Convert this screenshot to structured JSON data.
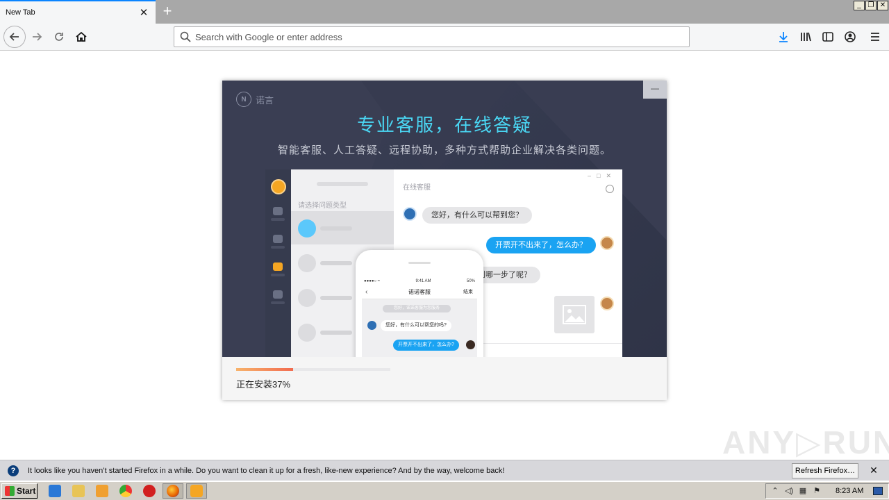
{
  "browser": {
    "tab_title": "New Tab",
    "tab_close": "✕",
    "new_tab": "+",
    "url_placeholder": "Search with Google or enter address",
    "url_value": "",
    "window_controls": [
      "_",
      "❐",
      "✕"
    ],
    "accent_color": "#0a84ff",
    "toolbar_icons": [
      "download-icon",
      "library-icon",
      "sidebar-icon",
      "account-icon",
      "menu-icon"
    ]
  },
  "installer": {
    "brand": "诺言",
    "brand_logo_text": "N",
    "minimize": "—",
    "title": "专业客服，在线答疑",
    "subtitle": "智能客服、人工答疑、远程协助，多种方式帮助企业解决各类问题。",
    "title_color": "#4ad8f5",
    "preview": {
      "header": "在线客服",
      "list_hint": "请选择问题类型",
      "messages": [
        {
          "from": "agent",
          "text": "您好，有什么可以帮到您？"
        },
        {
          "from": "user",
          "text": "开票开不出来了，怎么办？"
        },
        {
          "from": "agent",
          "text": "到哪一步了呢？"
        }
      ],
      "phone": {
        "carrier": "●●●●○ ≈",
        "time": "9:41 AM",
        "battery": "50%",
        "title": "诺诺客服",
        "end": "结束",
        "system_note": "您好，诺诺客服为您服务",
        "msg_in": "您好，有什么可以帮您的吗?",
        "msg_out": "开票开不出来了，怎么办?"
      }
    },
    "progress_value": 0.37,
    "progress_text": "正在安装37%"
  },
  "notification": {
    "message": "It looks like you haven’t started Firefox in a while. Do you want to clean it up for a fresh, like-new experience? And by the way, welcome back!",
    "button": "Refresh Firefox…",
    "close": "✕"
  },
  "taskbar": {
    "start": "Start",
    "clock": "8:23 AM"
  },
  "watermark": "ANY▷RUN"
}
